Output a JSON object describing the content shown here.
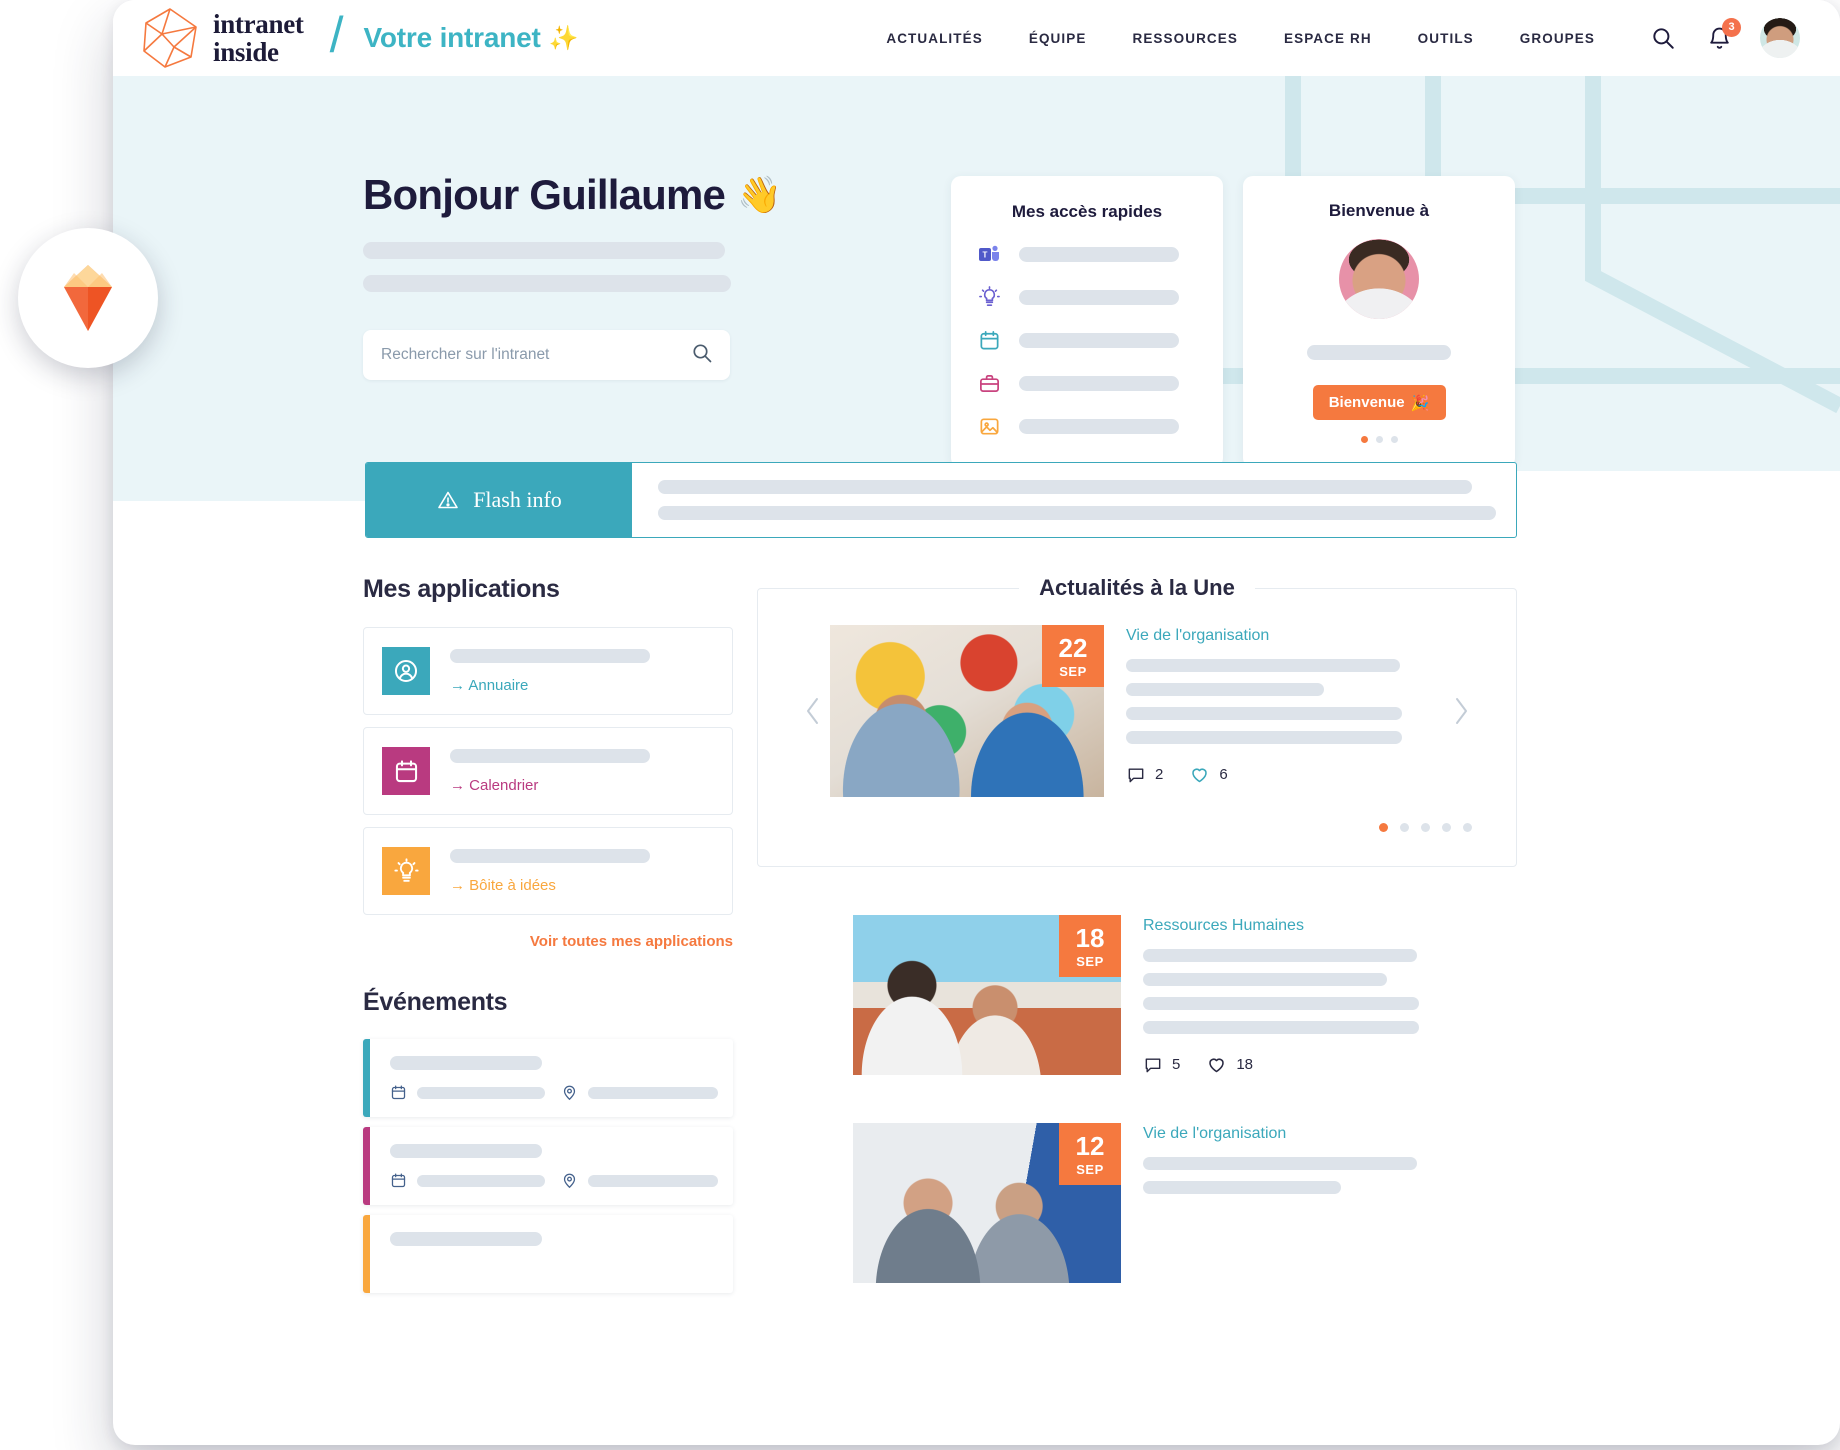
{
  "header": {
    "logo_line1": "intranet",
    "logo_line2": "inside",
    "divider": "/",
    "tagline": "Votre intranet",
    "tagline_emoji": "✨",
    "nav": [
      {
        "label": "ACTUALITÉS"
      },
      {
        "label": "ÉQUIPE"
      },
      {
        "label": "RESSOURCES"
      },
      {
        "label": "ESPACE RH"
      },
      {
        "label": "OUTILS"
      },
      {
        "label": "GROUPES"
      }
    ],
    "search_icon": "search-icon",
    "bell_icon": "bell-icon",
    "notification_count": "3",
    "avatar": "user-avatar"
  },
  "hero": {
    "greeting": "Bonjour Guillaume",
    "greeting_emoji": "👋",
    "search_placeholder": "Rechercher sur l'intranet",
    "search_value": "",
    "quick_access": {
      "title": "Mes accès rapides",
      "items": [
        {
          "icon": "teams-icon"
        },
        {
          "icon": "lightbulb-icon"
        },
        {
          "icon": "calendar-icon"
        },
        {
          "icon": "briefcase-icon"
        },
        {
          "icon": "image-icon"
        }
      ]
    },
    "welcome": {
      "title": "Bienvenue à",
      "button_label": "Bienvenue",
      "button_emoji": "🎉",
      "dots": 3,
      "active_dot": 0
    }
  },
  "flash": {
    "label": "Flash info",
    "icon": "alert-triangle-icon"
  },
  "applications": {
    "title": "Mes applications",
    "items": [
      {
        "label": "Annuaire",
        "icon": "user-circle-icon",
        "color": "#3ba8bb"
      },
      {
        "label": "Calendrier",
        "icon": "calendar-icon",
        "color": "#b93a80"
      },
      {
        "label": "Bôite à idées",
        "icon": "lightbulb-icon",
        "color": "#f9a73e"
      }
    ],
    "see_all": "Voir toutes mes applications"
  },
  "events": {
    "title": "Événements",
    "items": [
      {
        "color": "#3ba8bb",
        "calendar_icon": "calendar-icon",
        "location_icon": "map-pin-icon"
      },
      {
        "color": "#b93a80",
        "calendar_icon": "calendar-icon",
        "location_icon": "map-pin-icon"
      },
      {
        "color": "#f9a73e",
        "calendar_icon": "calendar-icon",
        "location_icon": "map-pin-icon"
      }
    ]
  },
  "news": {
    "title": "Actualités à la Une",
    "prev_icon": "chevron-left-icon",
    "next_icon": "chevron-right-icon",
    "featured": {
      "day": "22",
      "month": "SEP",
      "category": "Vie de l'organisation",
      "comments": "2",
      "likes": "6",
      "comment_icon": "comment-icon",
      "like_icon": "heart-icon"
    },
    "dots": 5,
    "active_dot": 0,
    "items": [
      {
        "day": "18",
        "month": "SEP",
        "category": "Ressources Humaines",
        "comments": "5",
        "likes": "18",
        "comment_icon": "comment-icon",
        "like_icon": "heart-icon"
      },
      {
        "day": "12",
        "month": "SEP",
        "category": "Vie de l'organisation",
        "comment_icon": "comment-icon",
        "like_icon": "heart-icon"
      }
    ]
  },
  "overlay": {
    "sketch_badge": "sketch-logo-icon"
  },
  "colors": {
    "accent_orange": "#f5793f",
    "accent_teal": "#3ba8bb",
    "accent_pink": "#b93a80",
    "accent_yellow": "#f9a73e",
    "hero_bg": "#eaf5f8",
    "ink": "#1e1b3c",
    "skeleton": "#dde3ea"
  }
}
